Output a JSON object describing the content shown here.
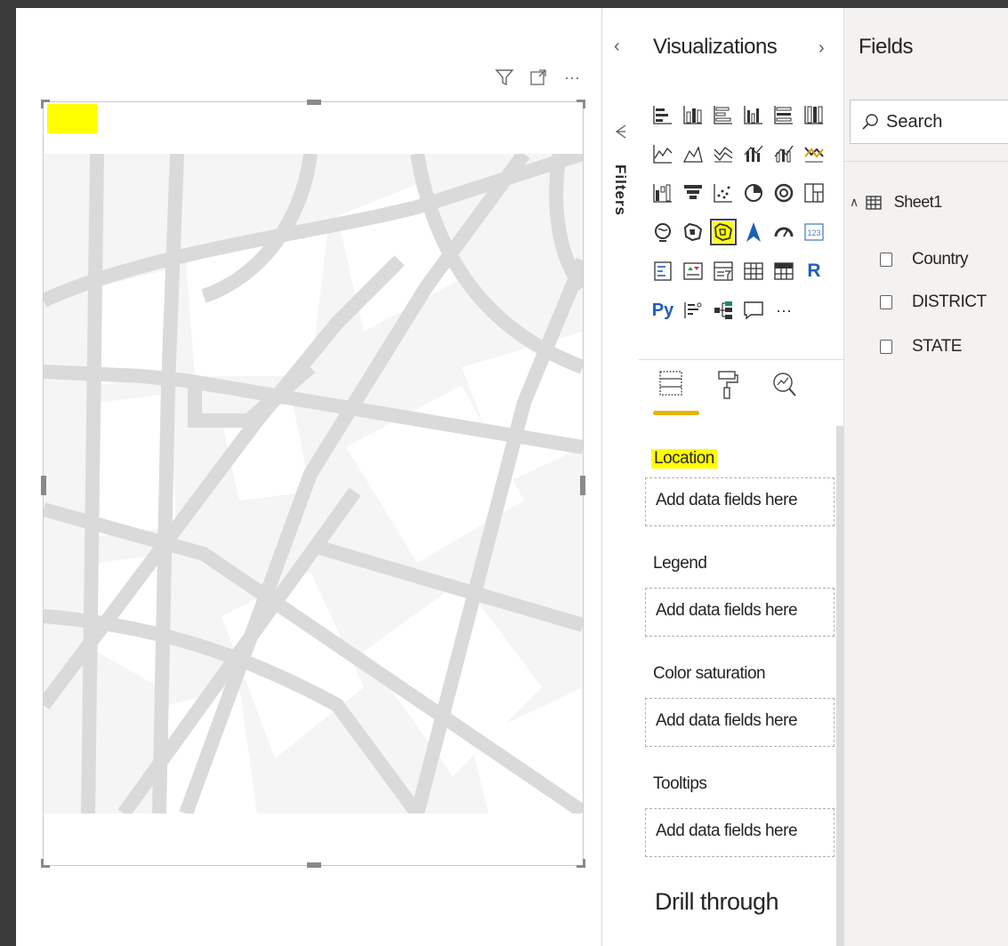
{
  "filters": {
    "label": "Filters"
  },
  "visualizations": {
    "title": "Visualizations",
    "icons": [
      "stacked-bar-chart-icon",
      "stacked-column-chart-icon",
      "clustered-bar-chart-icon",
      "clustered-column-chart-icon",
      "100-percent-bar-chart-icon",
      "100-percent-column-chart-icon",
      "line-chart-icon",
      "area-chart-icon",
      "stacked-area-chart-icon",
      "line-clustered-column-icon",
      "line-stacked-column-icon",
      "ribbon-chart-icon",
      "waterfall-chart-icon",
      "funnel-chart-icon",
      "scatter-chart-icon",
      "pie-chart-icon",
      "donut-chart-icon",
      "treemap-icon",
      "map-icon",
      "filled-map-icon",
      "shape-map-icon",
      "azure-map-icon",
      "gauge-icon",
      "card-icon",
      "multi-row-card-icon",
      "kpi-icon",
      "slicer-icon",
      "table-icon",
      "matrix-icon",
      "r-visual-icon",
      "python-visual-icon",
      "key-influencers-icon",
      "decomposition-tree-icon",
      "qa-icon",
      "more-visuals-icon"
    ],
    "r_label": "R",
    "py_label": "Py",
    "card_label": "123",
    "more_label": "···",
    "wells": [
      {
        "label": "Location",
        "placeholder": "Add data fields here"
      },
      {
        "label": "Legend",
        "placeholder": "Add data fields here"
      },
      {
        "label": "Color saturation",
        "placeholder": "Add data fields here"
      },
      {
        "label": "Tooltips",
        "placeholder": "Add data fields here"
      }
    ],
    "drill_through": "Drill through"
  },
  "fields": {
    "title": "Fields",
    "search_placeholder": "Search",
    "table_name": "Sheet1",
    "items": [
      "Country",
      "DISTRICT",
      "STATE"
    ]
  },
  "visual_header": {
    "more_label": "···"
  },
  "colors": {
    "highlight": "#ffff00",
    "accent": "#e6b400"
  }
}
